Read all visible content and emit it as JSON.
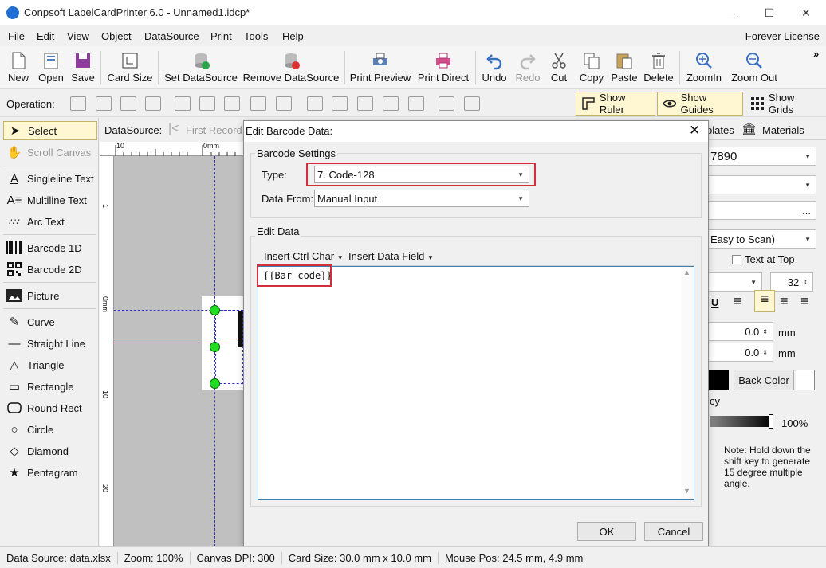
{
  "window": {
    "title": "Conpsoft LabelCardPrinter 6.0 - Unnamed1.idcp*",
    "minimize": "—",
    "maximize": "☐",
    "close": "✕"
  },
  "menu": {
    "items": [
      "File",
      "Edit",
      "View",
      "Object",
      "DataSource",
      "Print",
      "Tools",
      "Help"
    ],
    "license": "Forever License"
  },
  "toolbar": {
    "new": "New",
    "open": "Open",
    "save": "Save",
    "card_size": "Card Size",
    "set_datasource": "Set DataSource",
    "remove_datasource": "Remove DataSource",
    "print_preview": "Print Preview",
    "print_direct": "Print Direct",
    "undo": "Undo",
    "redo": "Redo",
    "cut": "Cut",
    "copy": "Copy",
    "paste": "Paste",
    "delete": "Delete",
    "zoom_in": "ZoomIn",
    "zoom_out": "Zoom Out",
    "more": "»"
  },
  "operation": {
    "label": "Operation:",
    "show_ruler": "Show Ruler",
    "show_guides": "Show Guides",
    "show_grids": "Show Grids"
  },
  "tools": {
    "select": "Select",
    "scroll_canvas": "Scroll Canvas",
    "singleline_text": "Singleline Text",
    "multiline_text": "Multiline Text",
    "arc_text": "Arc Text",
    "barcode_1d": "Barcode 1D",
    "barcode_2d": "Barcode 2D",
    "picture": "Picture",
    "curve": "Curve",
    "straight_line": "Straight Line",
    "triangle": "Triangle",
    "rectangle": "Rectangle",
    "round_rect": "Round Rect",
    "circle": "Circle",
    "diamond": "Diamond",
    "pentagram": "Pentagram"
  },
  "datasource_bar": {
    "label": "DataSource:",
    "first_record": "First Record"
  },
  "ruler": {
    "top_10": "10",
    "top_0": "0mm",
    "left_1": "1",
    "left_0": "0mm",
    "left_10": "10",
    "left_20": "20"
  },
  "right_panel": {
    "tab_templates": "plates",
    "tab_materials": "Materials",
    "data_value": "7890",
    "ellipsis": "...",
    "scan_mode": "Easy to Scan)",
    "text_at_top": "Text at Top",
    "font_size": "32",
    "underline": "U",
    "offset_x": "0.0",
    "offset_y": "0.0",
    "unit_mm_1": "mm",
    "unit_mm_2": "mm",
    "back_color": "Back Color",
    "opacity_label": "cy",
    "opacity_value": "100%",
    "note": "Note: Hold down the shift key to generate 15 degree multiple angle."
  },
  "dialog": {
    "title": "Edit Barcode Data:",
    "barcode_settings": "Barcode Settings",
    "type_label": "Type:",
    "type_value": "7.  Code-128",
    "data_from_label": "Data From:",
    "data_from_value": "Manual Input",
    "edit_data": "Edit Data",
    "insert_ctrl_char": "Insert Ctrl Char",
    "insert_data_field": "Insert Data Field",
    "data_text": "{{Bar code}}",
    "ok": "OK",
    "cancel": "Cancel"
  },
  "status": {
    "data_source": "Data Source: data.xlsx",
    "zoom": "Zoom: 100%",
    "dpi": "Canvas DPI: 300",
    "card_size": "Card Size: 30.0 mm x 10.0 mm",
    "mouse_pos": "Mouse Pos: 24.5 mm, 4.9 mm"
  },
  "colors": {
    "highlight": "#d32f3a",
    "toggle_bg": "#fff6d2",
    "handle": "#22dd22",
    "guide": "#3333cc"
  }
}
